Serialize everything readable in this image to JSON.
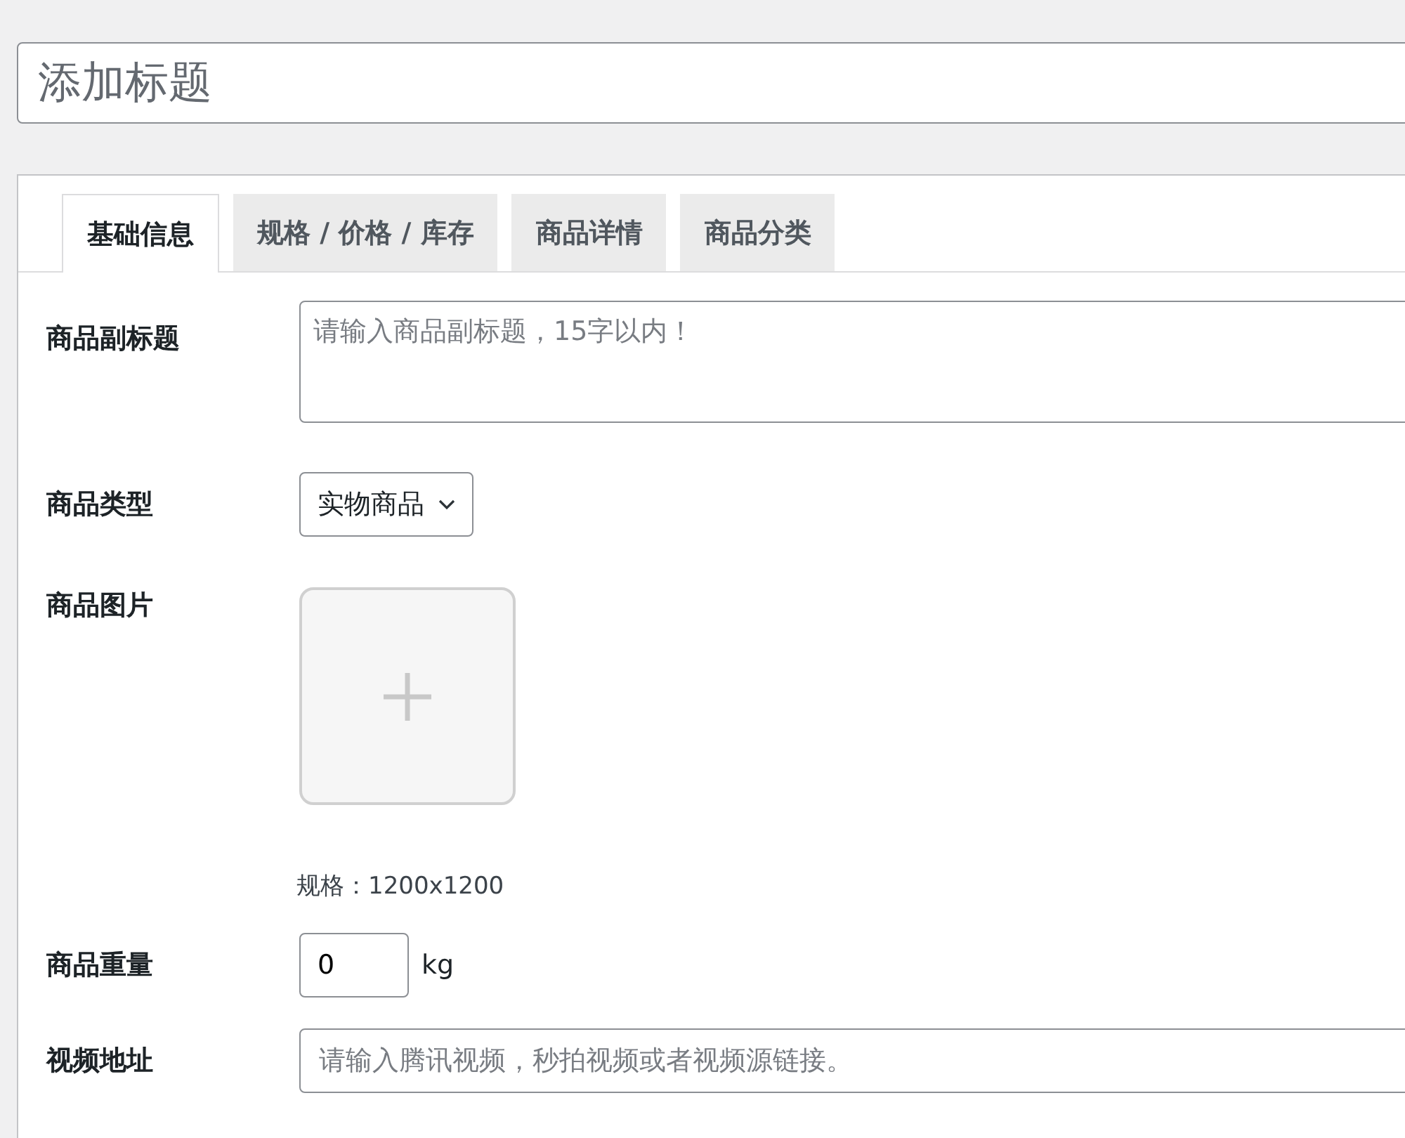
{
  "title_field": {
    "placeholder": "添加标题"
  },
  "tabs": [
    {
      "label": "基础信息",
      "selected": true
    },
    {
      "label": "规格 / 价格 / 库存",
      "selected": false
    },
    {
      "label": "商品详情",
      "selected": false
    },
    {
      "label": "商品分类",
      "selected": false
    }
  ],
  "fields": [
    {
      "kind": "textarea",
      "label": "商品副标题",
      "placeholder": "请输入商品副标题，15字以内！"
    },
    {
      "kind": "select",
      "label": "商品类型",
      "value": "实物商品"
    },
    {
      "kind": "image",
      "label": "商品图片",
      "hint": "规格：1200x1200"
    },
    {
      "kind": "number",
      "label": "商品重量",
      "value": "0",
      "unit": "kg"
    },
    {
      "kind": "text",
      "label": "视频地址",
      "placeholder": "请输入腾讯视频，秒拍视频或者视频源链接。"
    }
  ]
}
